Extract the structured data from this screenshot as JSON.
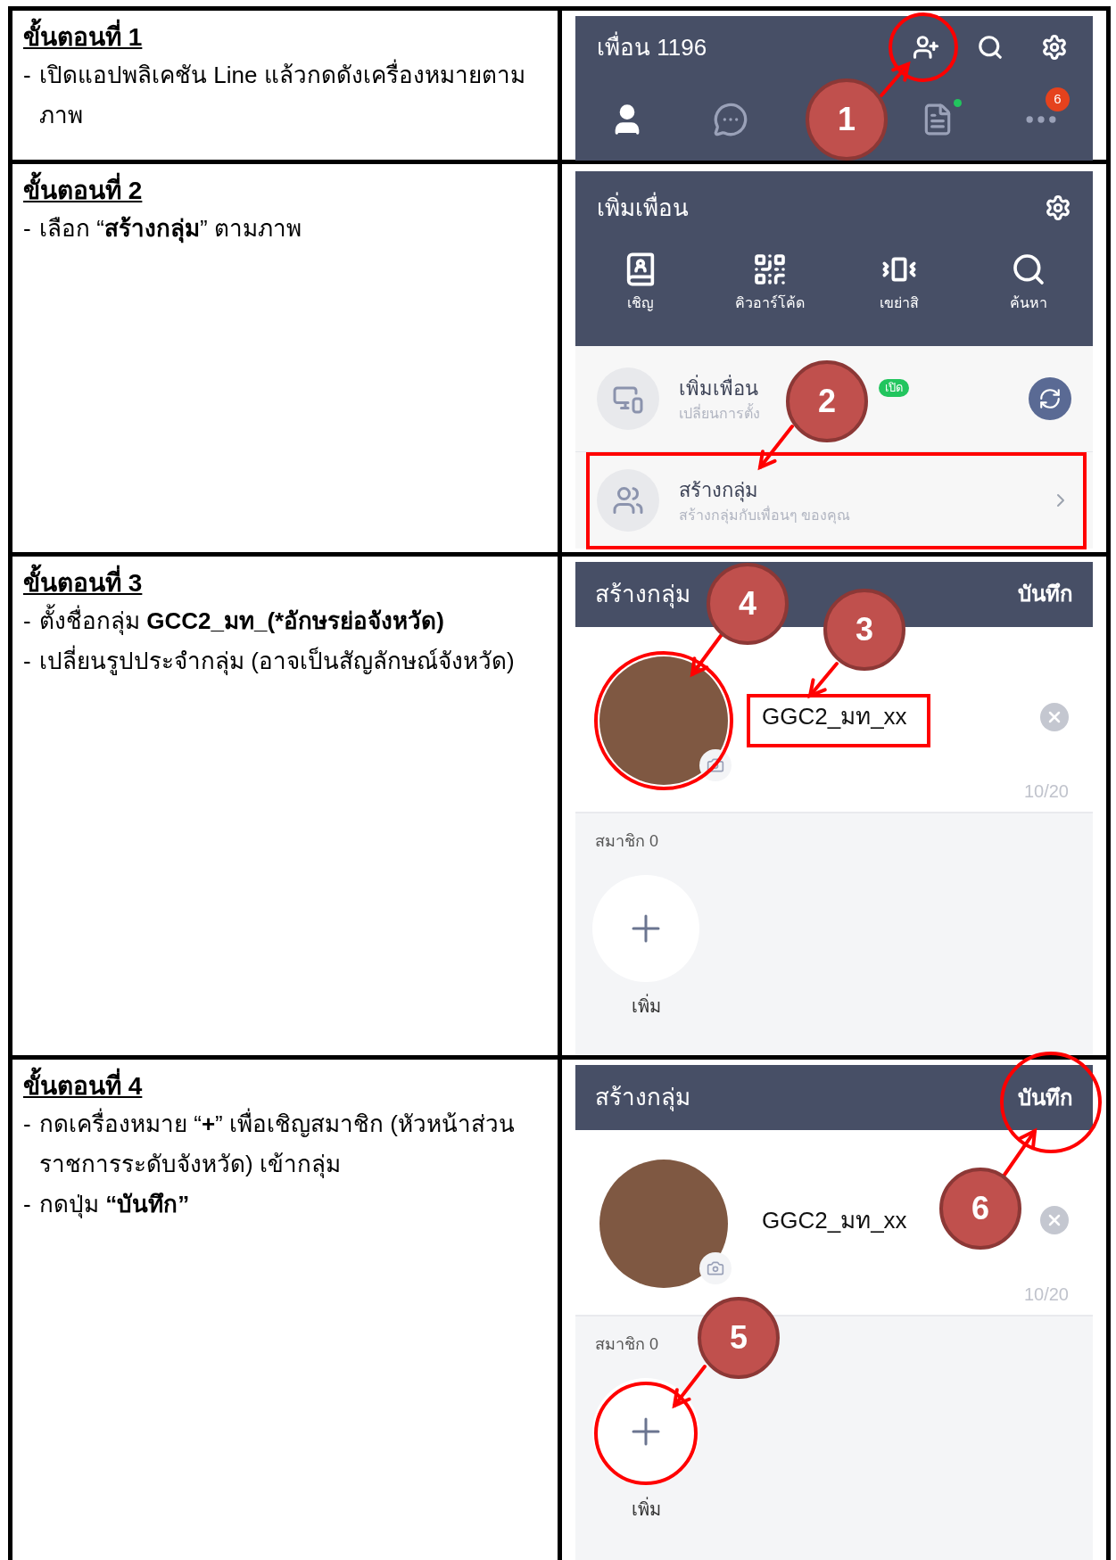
{
  "steps": [
    {
      "title": "ขั้นตอนที่ 1",
      "bullets": [
        {
          "marker": "-",
          "parts": [
            {
              "text": "เปิดแอปพลิเคชัน Line แล้วกดดังเครื่องหมายตามภาพ"
            }
          ]
        }
      ],
      "screen": {
        "kind": "friends",
        "title": "เพื่อน 1196",
        "notice_badge": "6",
        "callouts": [
          {
            "number": "1",
            "kind": "add_friend_icon"
          }
        ]
      }
    },
    {
      "title": "ขั้นตอนที่ 2",
      "bullets": [
        {
          "marker": "-",
          "parts": [
            {
              "text": "เลือก “"
            },
            {
              "text": "สร้างกลุ่ม",
              "bold": true
            },
            {
              "text": "” ตามภาพ"
            }
          ]
        }
      ],
      "screen": {
        "kind": "add_friend",
        "title": "เพิ่มเพื่อน",
        "actions": [
          "เชิญ",
          "คิวอาร์โค้ด",
          "เขย่าสิ",
          "ค้นหา"
        ],
        "rows": [
          {
            "title": "เพิ่มเพื่อน",
            "subtitle": "เปลี่ยนการตั้ง",
            "tag": "เปิด"
          },
          {
            "title": "สร้างกลุ่ม",
            "subtitle": "สร้างกลุ่มกับเพื่อนๆ ของคุณ"
          }
        ],
        "callouts": [
          {
            "number": "2",
            "kind": "create_group_row"
          }
        ]
      }
    },
    {
      "title": "ขั้นตอนที่ 3",
      "bullets": [
        {
          "marker": "-",
          "parts": [
            {
              "text": "ตั้งชื่อกลุ่ม "
            },
            {
              "text": "GCC2_มท_(*อักษรย่อจังหวัด)",
              "bold": true
            }
          ]
        },
        {
          "marker": "-",
          "parts": [
            {
              "text": "เปลี่ยนรูปประจำกลุ่ม (อาจเป็นสัญลักษณ์จังหวัด)"
            }
          ]
        }
      ],
      "screen": {
        "kind": "create_group",
        "title": "สร้างกลุ่ม",
        "save": "บันทึก",
        "group_name": "GGC2_มท_xx",
        "counter": "10/20",
        "members_label": "สมาชิก 0",
        "add_label": "เพิ่ม",
        "callouts": [
          {
            "number": "4",
            "kind": "avatar"
          },
          {
            "number": "3",
            "kind": "group_name"
          }
        ]
      }
    },
    {
      "title": "ขั้นตอนที่ 4",
      "bullets": [
        {
          "marker": "-",
          "parts": [
            {
              "text": "กดเครื่องหมาย “"
            },
            {
              "text": "+",
              "bold": true
            },
            {
              "text": "” เพื่อเชิญสมาชิก (หัวหน้าส่วนราชการระดับจังหวัด) เข้ากลุ่ม"
            }
          ]
        },
        {
          "marker": "-",
          "parts": [
            {
              "text": "กดปุ่ม "
            },
            {
              "text": "“บันทึก”",
              "bold": true
            }
          ]
        }
      ],
      "screen": {
        "kind": "create_group",
        "title": "สร้างกลุ่ม",
        "save": "บันทึก",
        "group_name": "GGC2_มท_xx",
        "counter": "10/20",
        "members_label": "สมาชิก 0",
        "add_label": "เพิ่ม",
        "callouts": [
          {
            "number": "6",
            "kind": "save"
          },
          {
            "number": "5",
            "kind": "add_member"
          }
        ]
      }
    }
  ]
}
